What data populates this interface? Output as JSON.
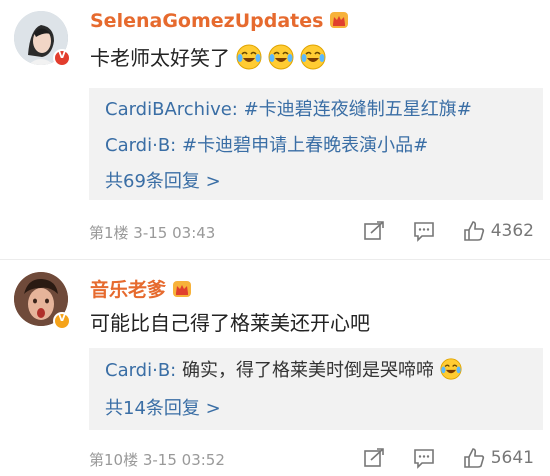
{
  "comments": [
    {
      "username": "SelenaGomezUpdates",
      "verified_badge": "V",
      "text": "卡老师太好笑了",
      "emoji_count": 3,
      "replies": [
        {
          "author": "CardiBArchive:",
          "body": "#卡迪碧连夜缝制五星红旗#",
          "body_is_tag": true
        },
        {
          "author": "Cardi·B:",
          "body": "#卡迪碧申请上春晚表演小品#",
          "body_is_tag": true
        }
      ],
      "more_replies": "共69条回复 >",
      "floor_time": "第1楼  3-15 03:43",
      "likes": "4362"
    },
    {
      "username": "音乐老爹",
      "verified_badge": "V",
      "text": "可能比自己得了格莱美还开心吧",
      "replies": [
        {
          "author": "Cardi·B:",
          "body": "确实，得了格莱美时倒是哭啼啼",
          "body_is_tag": false
        }
      ],
      "more_replies": "共14条回复 >",
      "floor_time": "第10楼  3-15 03:52",
      "likes": "5641"
    }
  ],
  "colors": {
    "username": "#e66a2e",
    "link": "#3a6ea5",
    "reply_bg": "#f2f2f2",
    "meta": "#999999"
  },
  "icons": [
    "share-icon",
    "comment-icon",
    "like-icon",
    "crown-icon",
    "laughing-crying-emoji"
  ]
}
